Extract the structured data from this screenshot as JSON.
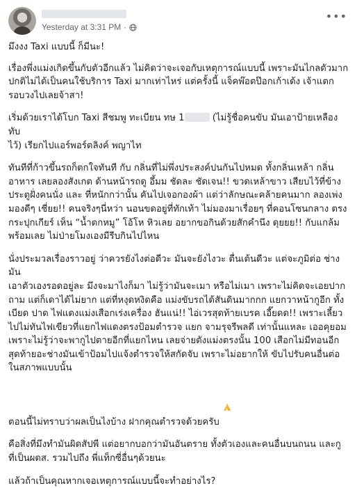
{
  "post": {
    "timestamp": "Yesterday at 3:31 PM",
    "separator": "·",
    "privacy_icon": "globe-icon",
    "more_icon": "more-options-icon",
    "title": "มึงงง Taxi แบบนี้ ก็มีนะ!",
    "p1": "เรื่องพึ่งแม่งเกิดขึ้นกับตัวอีกแล้ว ไม่คิดว่าจะเจอกับเหตุการณ์แบบนี้ เพราะมันไกลตัวมาก\nปกติไม่ได้เป็นคนใช้บริการ Taxi มากเท่าไหร่ แต่ครั้งนี้ แจ็คพ๊อตป๊อกเก้าเด้ง เจ้าแตก\nรอบวงไปเลยจ้าสา!",
    "p2_before": "เริ่มด้วยเราได้โบก Taxi สีชมพู ทะเบียน ทษ 1",
    "p2_after": " (ไม่รู้ชื่อคนขับ มันเอาป้ายเหลืองทับ\nไว้) เรียกไปแอร์พอร์ตลิงค์ พญาไท",
    "p3": "ทันทีที่ก้าวขึ้นรถก็ตกใจทันที กับ กลิ่นที่ไม่พึ่งประสงค์ปนกันไปหมด ทั้งกลิ่นเหล้า กลิ่น\nอาหาร เลยลองสังเกต ด้านหน้ารถดู อึ้มม ชัดละ ชัดเจน!! ขวดเหล้าขาว เสียบไว้ที่ข้าง\nประตูฝั่งคนนั่ง และ ที่หนักกว่านั้น คันไปเจอกองผ้า แต่ว่าลักษณะคล้ายคนมาก ลองเพ่ง\nมองดีๆ เชี่ยย!! คนจริงๆนี่หว่า นอนขดอยู่ที่ทักเท้า ไม่มองมาเรื่อยๆ ที่คอนโซนกลาง ตรง\nกระปุกเกียร์ เห็น “น้ำตกหมู” โอ้โห หิวเลย อยากขอกินด้วยสักคำนึง ดุยยย!! กับแกล้ม\nพร้อมเลย ไม่ป่ายโมงเองมีรีบกินไปไหน",
    "p4": "นั่งประมวลเรื่องราวอยู่ ว่าควรยังไงต่อดีวะ มันจะยังไงวะ ตื่นเต้นดีวะ แต่จะภูมิต่อ ช่างมัน\nเอาตัวเองรอดอยู่ละ มึงจะมาไงก็มา ไม่รู้ว่ามันจะเมา หรือไม่เมา เพราะไม่คิดจะเอยปาก\nถาม แต่ก็เดาได้ไม่ยาก แต่ที่หงุดหงิดคือ แม่งขับรถได้สันดินมากกก แยกวาหน้ากูอีก ทั้ง\nเบียด ปาด ไฟแดงแม่งเสือกเร่งเครื่อง ฮันแน่!! ไอ่เวรสุดท้ายเบรค เอี๊ยดด!! เพราะเลี้ยว\nไปไม่ทันไฟเขียวที่แยกไฟแดงตรงป้อมตำรวจ แยก จามรุจรีพลดี เท่านั้นแหละ เออคุยอม\nเพราะไม่รู้ว่าจะพากูไปตายอีกที่แยกไหน เลยจ่ายตังแม่งตรงนั้น 100 เสือกไม่มีทอนอีก\nสุดท้ายอะช่างมันเข้าป้อมไปแจ้งตำรวจให้สกัดจับ เพราะไม่อยากให้ ขับไปรับคนอื่นต่อ\nในสภาพแบบนั้น",
    "p4_last": "ตอนนี้ไม่ทราบว่าผลเป็นไงบ้าง ฝากคุณตำรวจด้วยครับ",
    "p4_emoji": "folded-hands-icon",
    "p5": "คือสิ่งที่มึงทำมันผิดสัปพี แต่อยากบอกว่ามันอันตราย ทั้งตัวเองและคนอื่นบนถนน และกู\nที่เป็นผดส. รวมไปถึง พี่แท็กซี่อื่นๆด้วยนะ",
    "p6": "แล้วถ้าเป็นคุณหากเจอเหตุการณ์แบบนี้จะทำอย่างไร?",
    "colors": {
      "text": "#1c1e21",
      "meta": "#606770",
      "redaction": "#e4e6eb"
    }
  }
}
